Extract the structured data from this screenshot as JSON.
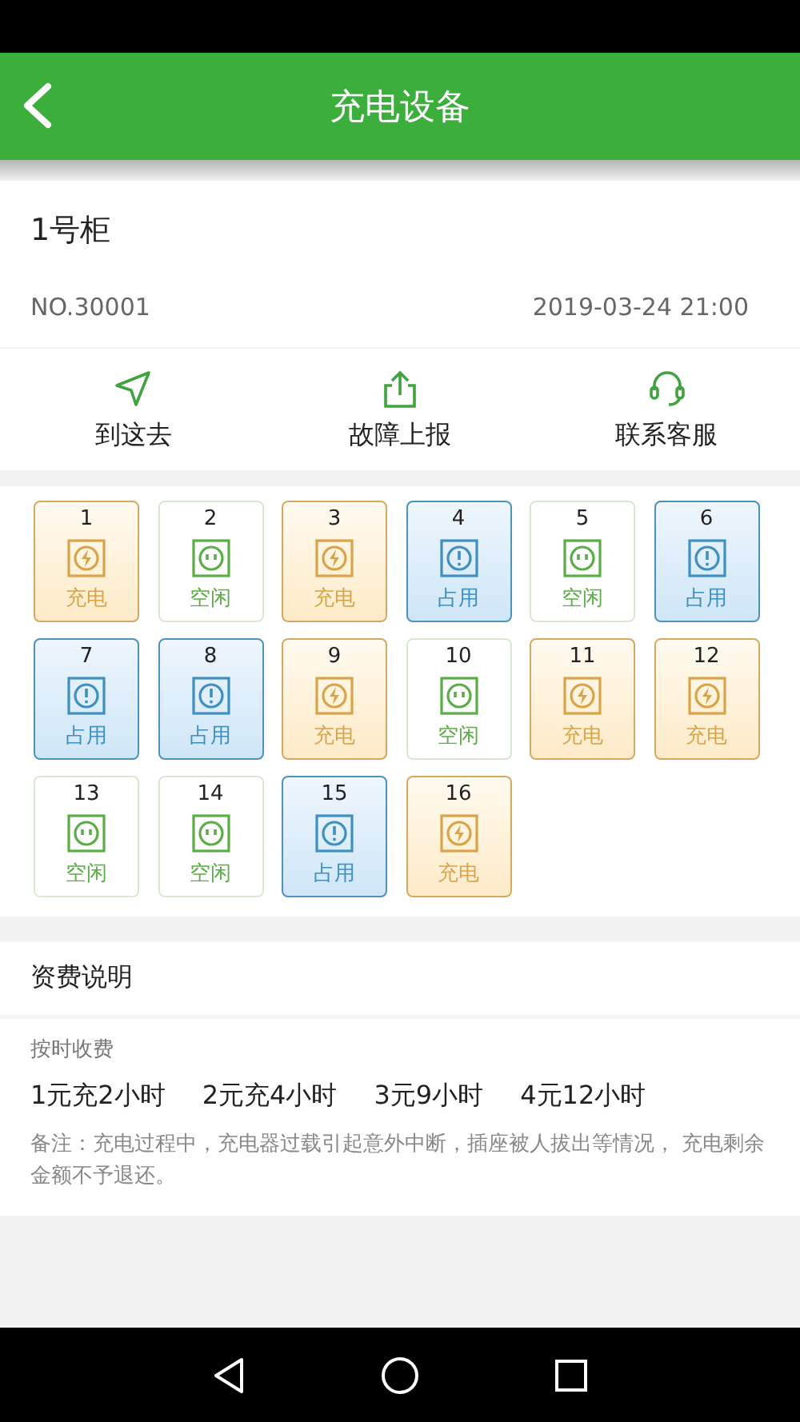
{
  "header": {
    "title": "充电设备"
  },
  "cabinet": {
    "name": "1号柜",
    "number": "NO.30001",
    "time": "2019-03-24 21:00"
  },
  "actions": [
    {
      "kind": "navigate",
      "label": "到这去"
    },
    {
      "kind": "report",
      "label": "故障上报"
    },
    {
      "kind": "service",
      "label": "联系客服"
    }
  ],
  "slots": [
    {
      "number": "1",
      "kind": "charging",
      "status": "充电"
    },
    {
      "number": "2",
      "kind": "idle",
      "status": "空闲"
    },
    {
      "number": "3",
      "kind": "charging",
      "status": "充电"
    },
    {
      "number": "4",
      "kind": "occupied",
      "status": "占用"
    },
    {
      "number": "5",
      "kind": "idle",
      "status": "空闲"
    },
    {
      "number": "6",
      "kind": "occupied",
      "status": "占用"
    },
    {
      "number": "7",
      "kind": "occupied",
      "status": "占用"
    },
    {
      "number": "8",
      "kind": "occupied",
      "status": "占用"
    },
    {
      "number": "9",
      "kind": "charging",
      "status": "充电"
    },
    {
      "number": "10",
      "kind": "idle",
      "status": "空闲"
    },
    {
      "number": "11",
      "kind": "charging",
      "status": "充电"
    },
    {
      "number": "12",
      "kind": "charging",
      "status": "充电"
    },
    {
      "number": "13",
      "kind": "idle",
      "status": "空闲"
    },
    {
      "number": "14",
      "kind": "idle",
      "status": "空闲"
    },
    {
      "number": "15",
      "kind": "occupied",
      "status": "占用"
    },
    {
      "number": "16",
      "kind": "charging",
      "status": "充电"
    }
  ],
  "fees": {
    "title": "资费说明",
    "subtitle": "按时收费",
    "plans": [
      "1元充2小时",
      "2元充4小时",
      "3元9小时",
      "4元12小时"
    ],
    "note": "备注：充电过程中，充电器过载引起意外中断，插座被人拔出等情况， 充电剩余金额不予退还。"
  }
}
